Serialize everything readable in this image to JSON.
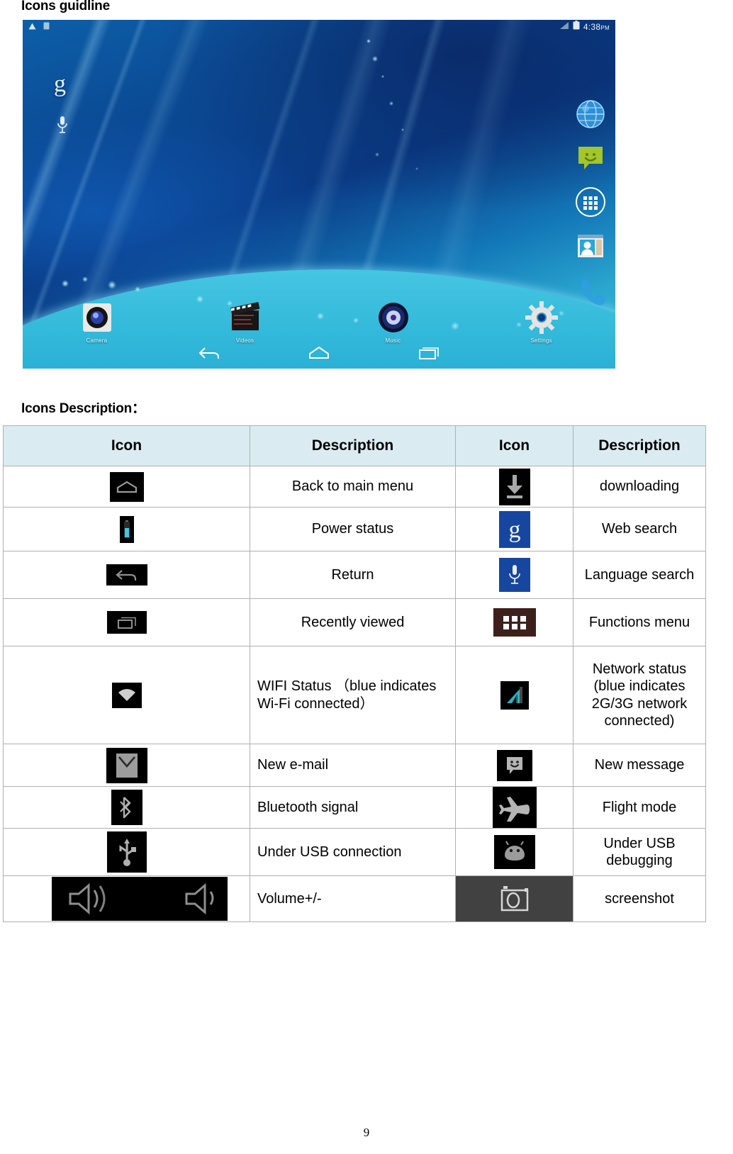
{
  "headings": {
    "title": "Icons guidline",
    "subtitle": "Icons Description："
  },
  "screenshot": {
    "status_bar": {
      "time": "4:38",
      "meridiem": "PM",
      "left_icons": [
        "warning-triangle-icon",
        "sd-card-icon"
      ],
      "right_icons": [
        "signal-bars-icon",
        "battery-icon"
      ]
    },
    "search_widget": {
      "google_logo": "g",
      "voice_icon": "microphone-icon"
    },
    "dock_items": [
      {
        "name": "browser-icon",
        "label": ""
      },
      {
        "name": "messaging-icon",
        "label": ""
      },
      {
        "name": "app-drawer-icon",
        "label": ""
      },
      {
        "name": "contacts-icon",
        "label": ""
      },
      {
        "name": "phone-icon",
        "label": ""
      }
    ],
    "apps": [
      {
        "label": "Camera",
        "icon": "camera-app-icon"
      },
      {
        "label": "Videos",
        "icon": "videos-app-icon"
      },
      {
        "label": "Music",
        "icon": "music-app-icon"
      },
      {
        "label": "Settings",
        "icon": "settings-app-icon"
      }
    ],
    "nav_buttons": [
      {
        "name": "back-button",
        "icon": "back-arrow-icon"
      },
      {
        "name": "home-button",
        "icon": "home-icon"
      },
      {
        "name": "recents-button",
        "icon": "recent-apps-icon"
      }
    ]
  },
  "table": {
    "headers": [
      "Icon",
      "Description",
      "Icon",
      "Description"
    ],
    "rows": [
      {
        "left_icon": "home-icon",
        "left_desc": "Back to main menu",
        "right_icon": "download-icon",
        "right_desc": "downloading"
      },
      {
        "left_icon": "battery-icon",
        "left_desc": "Power status",
        "right_icon": "google-search-icon",
        "right_desc": "Web search"
      },
      {
        "left_icon": "back-arrow-icon",
        "left_desc": "Return",
        "right_icon": "microphone-icon",
        "right_desc": "Language search"
      },
      {
        "left_icon": "recent-apps-icon",
        "left_desc": "Recently viewed",
        "right_icon": "app-grid-icon",
        "right_desc": "Functions menu"
      },
      {
        "left_icon": "wifi-icon",
        "left_desc": "WIFI Status （blue indicates Wi-Fi connected）",
        "right_icon": "signal-bars-icon",
        "right_desc": "Network status (blue indicates 2G/3G network connected)"
      },
      {
        "left_icon": "envelope-icon",
        "left_desc": "New e-mail",
        "right_icon": "message-bubble-icon",
        "right_desc": "New message"
      },
      {
        "left_icon": "bluetooth-icon",
        "left_desc": "Bluetooth signal",
        "right_icon": "airplane-icon",
        "right_desc": "Flight mode"
      },
      {
        "left_icon": "usb-icon",
        "left_desc": "Under USB connection",
        "right_icon": "android-head-icon",
        "right_desc": "Under USB debugging"
      },
      {
        "left_icon": "volume-bar-icon",
        "left_desc": "Volume+/-",
        "right_icon": "screenshot-camera-icon",
        "right_desc": "screenshot"
      }
    ]
  },
  "footer": {
    "page_number": "9"
  },
  "colors": {
    "header_bg": "#daecf2",
    "border": "#b0b0b0",
    "icon_black": "#000000",
    "google_blue": "#17469e",
    "app_grid_brown": "#3d201c",
    "signal_teal": "#2bb3c4",
    "screenshot_gray": "#414141"
  }
}
